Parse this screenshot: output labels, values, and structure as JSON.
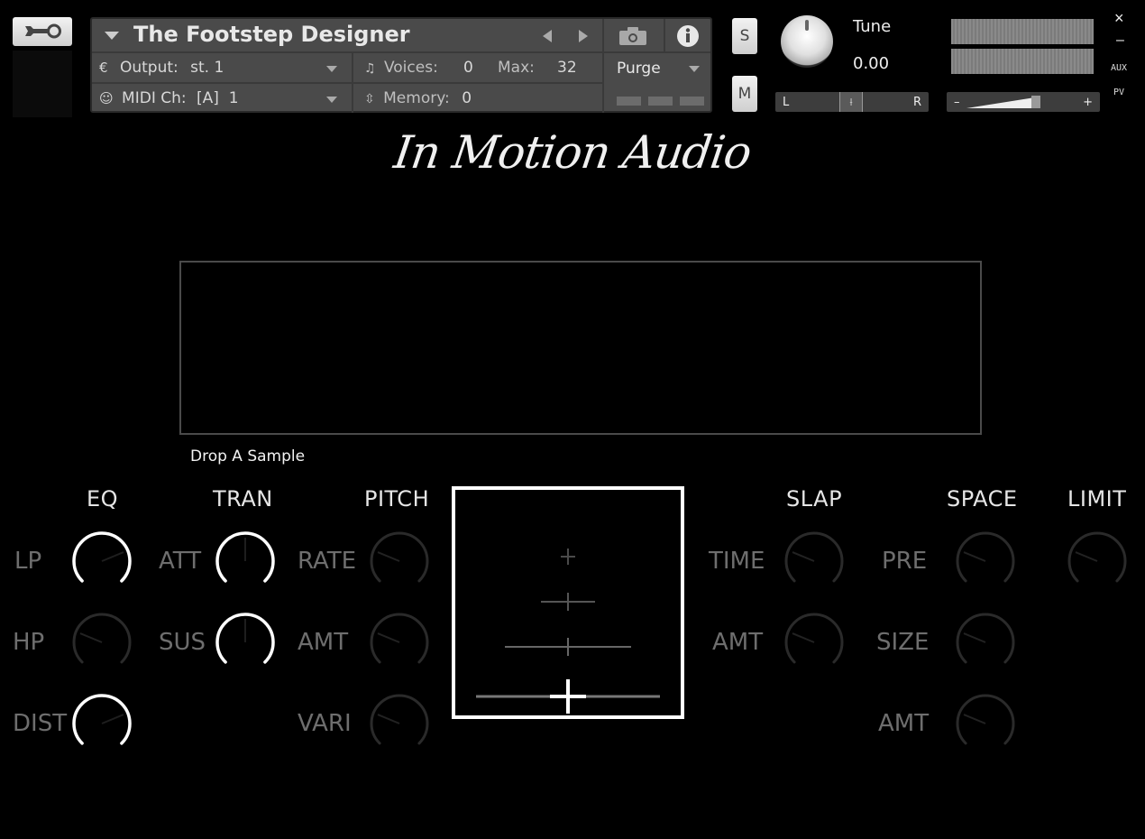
{
  "header": {
    "instrument_name": "The Footstep Designer",
    "output_label": "Output:",
    "output_value": "st. 1",
    "voices_label": "Voices:",
    "voices_value": "0",
    "max_label": "Max:",
    "max_value": "32",
    "purge_label": "Purge",
    "midi_label": "MIDI Ch:",
    "midi_value": "[A]  1",
    "memory_label": "Memory:",
    "memory_value": "0",
    "solo_label": "S",
    "mute_label": "M",
    "tune_label": "Tune",
    "tune_value": "0.00",
    "pan_left": "L",
    "pan_right": "R",
    "vol_minus": "–",
    "vol_plus": "+",
    "close_label": "×",
    "minimize_label": "–",
    "aux_label": "AUX",
    "pv_label": "PV"
  },
  "brand": {
    "logo_text": "In Motion Audio"
  },
  "drop_zone": {
    "label": "Drop A Sample"
  },
  "sections": {
    "eq": "EQ",
    "tran": "TRAN",
    "pitch": "PITCH",
    "slap": "SLAP",
    "space": "SPACE",
    "limit": "LIMIT"
  },
  "knobs": {
    "eq_lp": {
      "label": "LP",
      "value": 0.75,
      "active": true
    },
    "eq_hp": {
      "label": "HP",
      "value": 0.25,
      "active": false
    },
    "eq_dist": {
      "label": "DIST",
      "value": 0.75,
      "active": true
    },
    "tran_att": {
      "label": "ATT",
      "value": 0.5,
      "active": true
    },
    "tran_sus": {
      "label": "SUS",
      "value": 0.5,
      "active": true
    },
    "pitch_rate": {
      "label": "RATE",
      "value": 0.25,
      "active": false
    },
    "pitch_amt": {
      "label": "AMT",
      "value": 0.25,
      "active": false
    },
    "pitch_vari": {
      "label": "VARI",
      "value": 0.25,
      "active": false
    },
    "slap_time": {
      "label": "TIME",
      "value": 0.25,
      "active": false
    },
    "slap_amt": {
      "label": "AMT",
      "value": 0.25,
      "active": false
    },
    "space_pre": {
      "label": "PRE",
      "value": 0.25,
      "active": false
    },
    "space_size": {
      "label": "SIZE",
      "value": 0.25,
      "active": false
    },
    "space_amt": {
      "label": "AMT",
      "value": 0.25,
      "active": false
    },
    "limit": {
      "label": "",
      "value": 0.25,
      "active": false
    }
  },
  "icons": {
    "wrench": "wrench-icon",
    "camera": "camera-icon",
    "info": "info-icon"
  },
  "colors": {
    "active_arc": "#ffffff",
    "inactive_arc": "#2a2a2a",
    "header_bg": "#4a4a4a"
  }
}
